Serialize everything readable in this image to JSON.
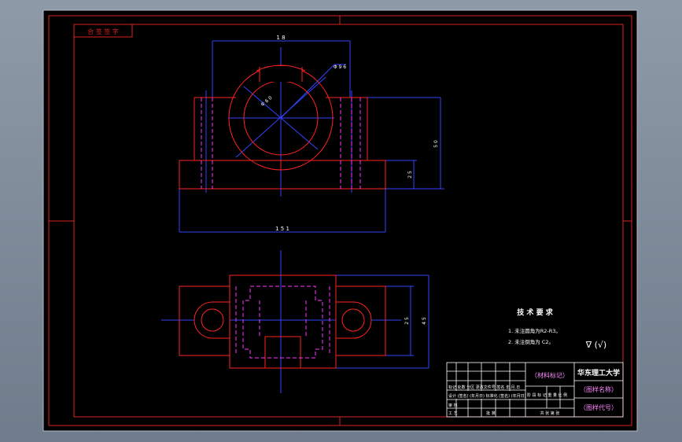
{
  "colors": {
    "background": "#000000",
    "border": "#dd2222",
    "dimension": "#3344ff",
    "centerline": "#3344ff",
    "hidden": "#ff33ff",
    "outline": "#ff2222",
    "text": "#ffffff",
    "title_text": "#ff88ff"
  },
  "drawing": {
    "corner_label": "合 签 签 字",
    "dim_top_width": "1 8",
    "dim_right_height": "5 0",
    "dim_right_small": "2 5",
    "dim_bottom_width": "1 5 1",
    "dim_outer_diameter": "Φ 9 6",
    "dim_inner_diameter": "Φ 6 0",
    "dim_plan_inner": "2 5",
    "dim_plan_outer": "4 5"
  },
  "tech": {
    "title": "技 术 要 求",
    "line1": "1. 未注圆角为R2-R3。",
    "line2": "2. 未注倒角为 C2。",
    "roughness": "∇ (√)"
  },
  "title_block": {
    "material": "（材料标记）",
    "school": "华东理工大学",
    "drawing_name": "（图样名称）",
    "drawing_code": "（图样代号）",
    "row_labels": "标记 处数  分区  更改文件号  签名  年.月.日",
    "row_labels2": "设计  (签名) (年月日)  标准化 (签名) (年月日)",
    "stage_labels": "阶 段 标 记    重 量   比 例",
    "audit": "审 核",
    "craft": "工 艺",
    "approve": "批 准",
    "sheet": "共  张   第  张"
  }
}
